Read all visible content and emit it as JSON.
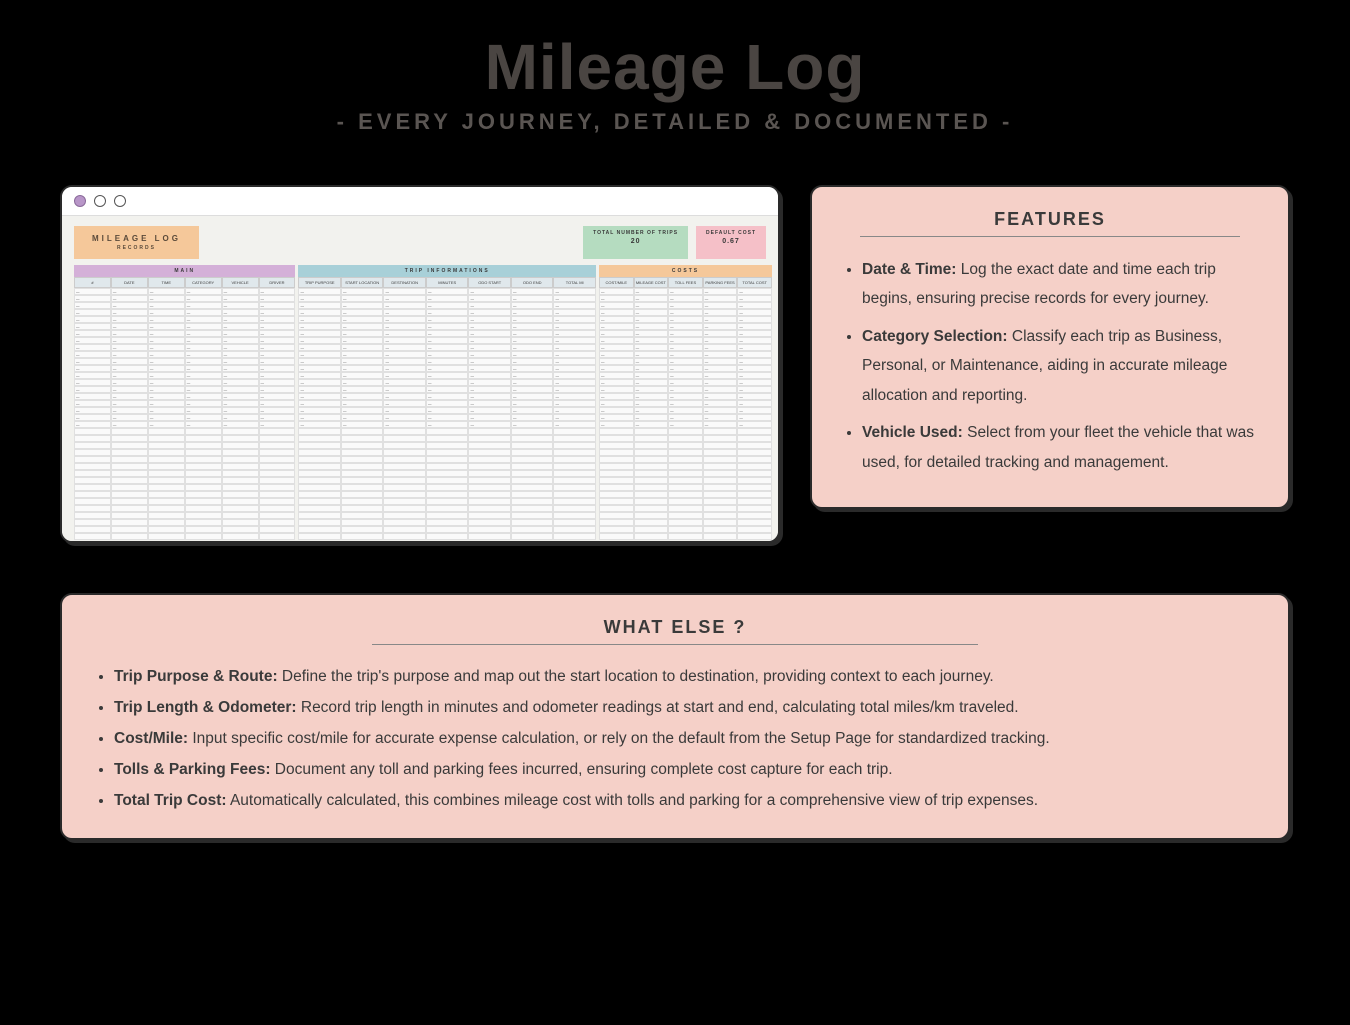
{
  "header": {
    "title": "Mileage Log",
    "subtitle": "- EVERY JOURNEY, DETAILED & DOCUMENTED -"
  },
  "spreadsheet": {
    "log_title": "MILEAGE LOG",
    "log_subtitle": "RECORDS",
    "summary_trips_label": "TOTAL NUMBER OF TRIPS",
    "summary_trips_value": "20",
    "summary_cost_label": "DEFAULT COST",
    "summary_cost_value": "0.67",
    "section_main": "MAIN",
    "section_trip": "TRIP INFORMATIONS",
    "section_cost": "COSTS",
    "main_cols": [
      "#",
      "DATE",
      "TIME",
      "CATEGORY",
      "VEHICLE",
      "DRIVER"
    ],
    "trip_cols": [
      "TRIP PURPOSE",
      "START LOCATION",
      "DESTINATION",
      "MINUTES",
      "ODO START",
      "ODO END",
      "TOTAL MI"
    ],
    "cost_cols": [
      "COST/MILE",
      "MILEAGE COST",
      "TOLL FEES",
      "PARKING FEES",
      "TOTAL COST"
    ]
  },
  "features": {
    "title": "FEATURES",
    "items": [
      {
        "b": "Date & Time:",
        "t": " Log the exact date and time each trip begins, ensuring precise records for every journey."
      },
      {
        "b": "Category Selection:",
        "t": " Classify each trip as Business, Personal, or Maintenance, aiding in accurate mileage allocation and reporting."
      },
      {
        "b": "Vehicle Used:",
        "t": " Select from your fleet the vehicle that was used, for detailed tracking and management."
      }
    ]
  },
  "whatelse": {
    "title": "WHAT ELSE ?",
    "items": [
      {
        "b": "Trip Purpose & Route:",
        "t": " Define the trip's purpose and map out the start location to destination, providing context to each journey."
      },
      {
        "b": "Trip Length & Odometer:",
        "t": " Record trip length in minutes and odometer readings at start and end, calculating total miles/km traveled."
      },
      {
        "b": "Cost/Mile:",
        "t": " Input specific cost/mile for accurate expense calculation, or rely on the default from the Setup Page for standardized tracking."
      },
      {
        "b": "Tolls & Parking Fees:",
        "t": " Document any toll and parking fees incurred, ensuring complete cost capture for each trip."
      },
      {
        "b": "Total Trip Cost:",
        "t": " Automatically calculated, this combines mileage cost with tolls and parking for a comprehensive view of trip expenses."
      }
    ]
  }
}
